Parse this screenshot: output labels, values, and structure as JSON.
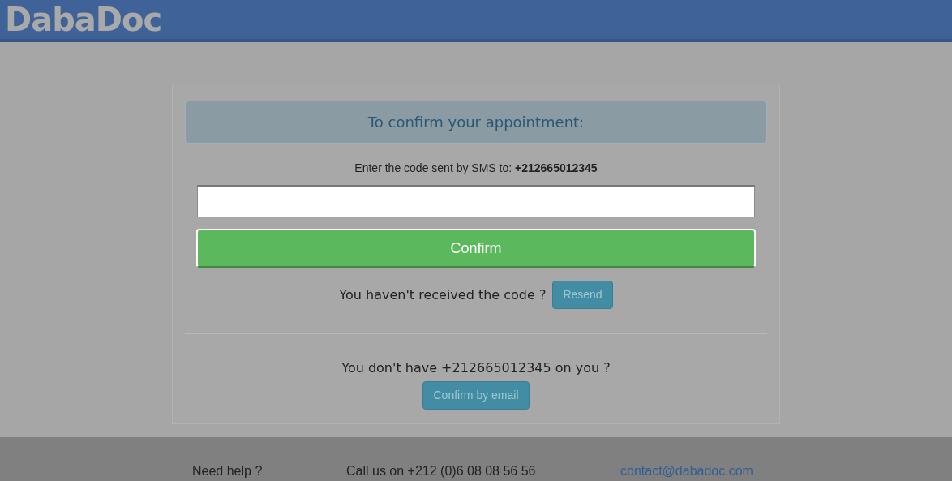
{
  "header": {
    "logo": "DabaDoc"
  },
  "card": {
    "title": "To confirm your appointment:",
    "instruction": "Enter the code sent by SMS to: **+212665012345**",
    "confirm_button": "Confirm",
    "resend_prompt": "You haven't received the code ?",
    "resend_button": "Resend",
    "alt_prompt": "You don't have +212665012345 on you ?",
    "email_button": "Confirm by email"
  },
  "footer": {
    "help": "Need help ?",
    "phone": "Call us on +212 (0)6 08 08 56 56",
    "email_link": "contact@dabadoc.com"
  }
}
